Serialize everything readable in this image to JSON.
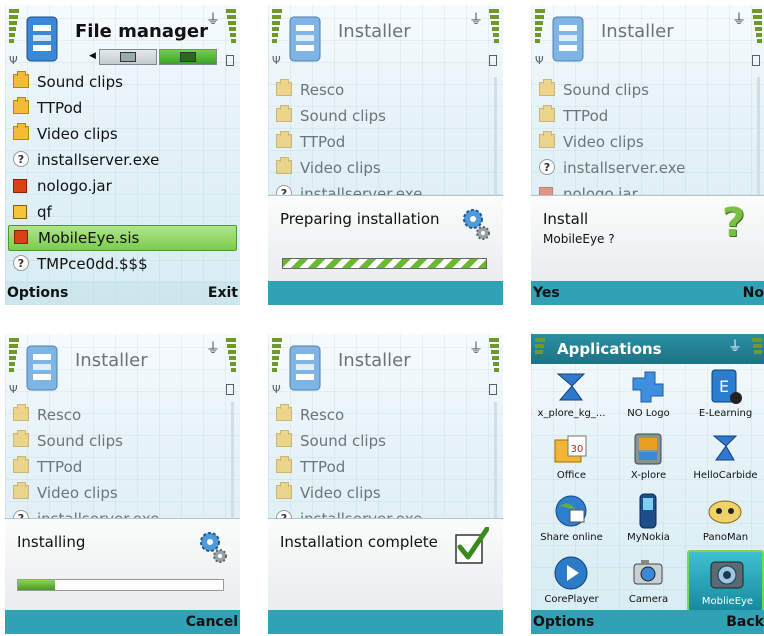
{
  "screens": {
    "file_manager": {
      "title": "File manager",
      "items": [
        {
          "label": "Sound clips",
          "icon": "folder-icon"
        },
        {
          "label": "TTPod",
          "icon": "folder-icon"
        },
        {
          "label": "Video clips",
          "icon": "folder-icon"
        },
        {
          "label": "installserver.exe",
          "icon": "unknown-file-icon"
        },
        {
          "label": "nologo.jar",
          "icon": "java-app-icon"
        },
        {
          "label": "qf",
          "icon": "qf-file-icon"
        },
        {
          "label": "MobileEye.sis",
          "icon": "sis-package-icon",
          "selected": true
        },
        {
          "label": "TMPce0dd.$$$",
          "icon": "unknown-file-icon"
        }
      ],
      "left_softkey": "Options",
      "right_softkey": "Exit"
    },
    "preparing": {
      "title": "Installer",
      "items": [
        "Resco",
        "Sound clips",
        "TTPod",
        "Video clips",
        "installserver.exe"
      ],
      "dialog_text": "Preparing installation"
    },
    "confirm": {
      "title": "Installer",
      "items": [
        "Sound clips",
        "TTPod",
        "Video clips",
        "installserver.exe",
        "nologo.jar"
      ],
      "dialog_text": "Install",
      "dialog_sub": "MobileEye ?",
      "left_softkey": "Yes",
      "right_softkey": "No"
    },
    "installing": {
      "title": "Installer",
      "items": [
        "Resco",
        "Sound clips",
        "TTPod",
        "Video clips",
        "installserver.exe"
      ],
      "dialog_text": "Installing",
      "progress": 0.18,
      "right_softkey": "Cancel"
    },
    "complete": {
      "title": "Installer",
      "items": [
        "Resco",
        "Sound clips",
        "TTPod",
        "Video clips",
        "installserver.exe"
      ],
      "dialog_text": "Installation complete"
    },
    "applications": {
      "title": "Applications",
      "apps": [
        {
          "label": "x_plore_kg_...",
          "icon": "x-plore-kg-icon"
        },
        {
          "label": "NO Logo",
          "icon": "no-logo-icon"
        },
        {
          "label": "E-Learning",
          "icon": "e-learning-icon"
        },
        {
          "label": "Office",
          "icon": "office-icon"
        },
        {
          "label": "X-plore",
          "icon": "x-plore-icon"
        },
        {
          "label": "HelloCarbide",
          "icon": "hello-carbide-icon"
        },
        {
          "label": "Share online",
          "icon": "share-online-icon"
        },
        {
          "label": "MyNokia",
          "icon": "my-nokia-icon"
        },
        {
          "label": "PanoMan",
          "icon": "panoman-icon"
        },
        {
          "label": "CorePlayer",
          "icon": "coreplayer-icon"
        },
        {
          "label": "Camera",
          "icon": "camera-icon"
        },
        {
          "label": "MoblieEye",
          "icon": "mobileeye-icon",
          "selected": true
        }
      ],
      "left_softkey": "Options",
      "right_softkey": "Back"
    }
  }
}
